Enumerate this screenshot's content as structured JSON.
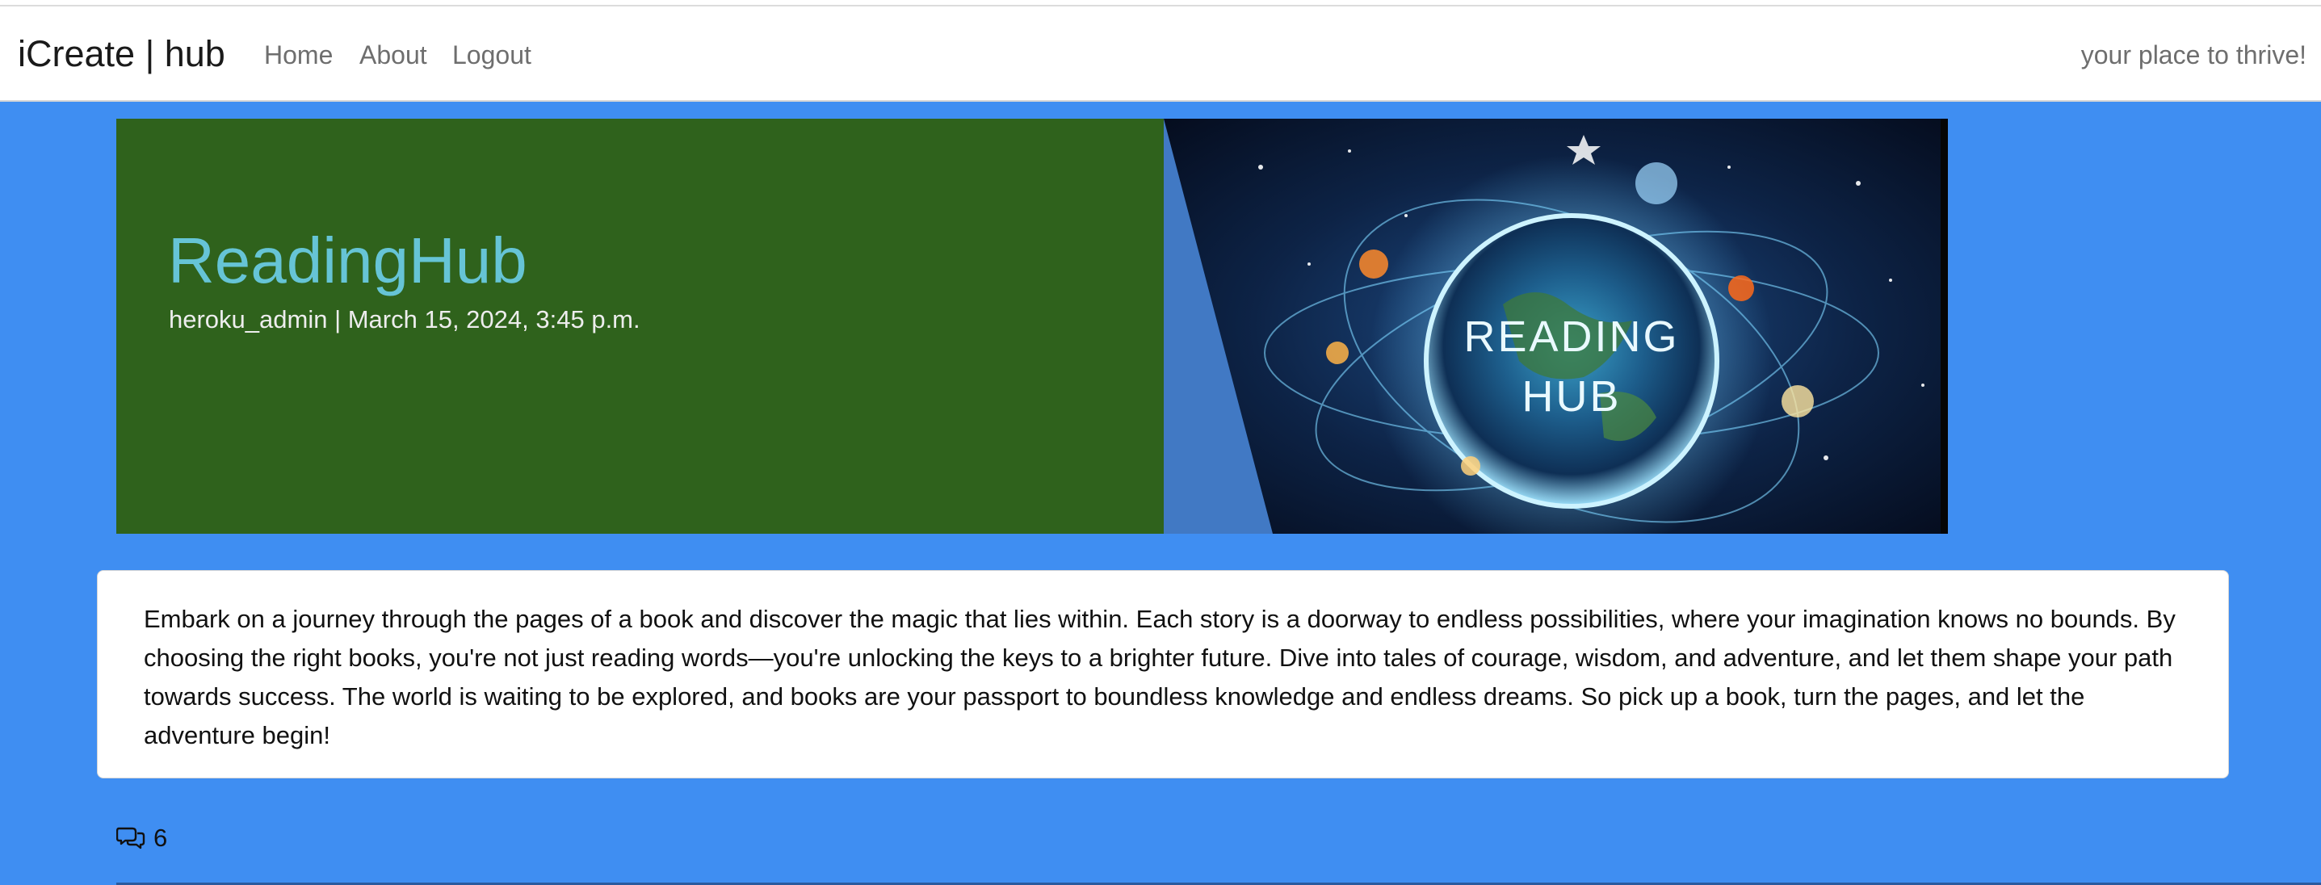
{
  "navbar": {
    "brand": "iCreate | hub",
    "links": [
      "Home",
      "About",
      "Logout"
    ],
    "tagline": "your place to thrive!"
  },
  "hero": {
    "title": "ReadingHub",
    "meta": "heroku_admin | March 15, 2024, 3:45 p.m.",
    "image_text": [
      "READING",
      "HUB"
    ]
  },
  "post": {
    "body": "Embark on a journey through the pages of a book and discover the magic that lies within. Each story is a doorway to endless possibilities, where your imagination knows no bounds. By choosing the right books, you're not just reading words—you're unlocking the keys to a brighter future. Dive into tales of courage, wisdom, and adventure, and let them shape your path towards success. The world is waiting to be explored, and books are your passport to boundless knowledge and endless dreams. So pick up a book, turn the pages, and let the adventure begin!"
  },
  "comments": {
    "icon": "chat-bubbles-icon",
    "count": "6"
  },
  "colors": {
    "page_background": "#3f8ef2",
    "hero_panel": "#2f621c",
    "hero_title": "#66c4d6",
    "hero_image_backdrop": "#4179c4"
  }
}
